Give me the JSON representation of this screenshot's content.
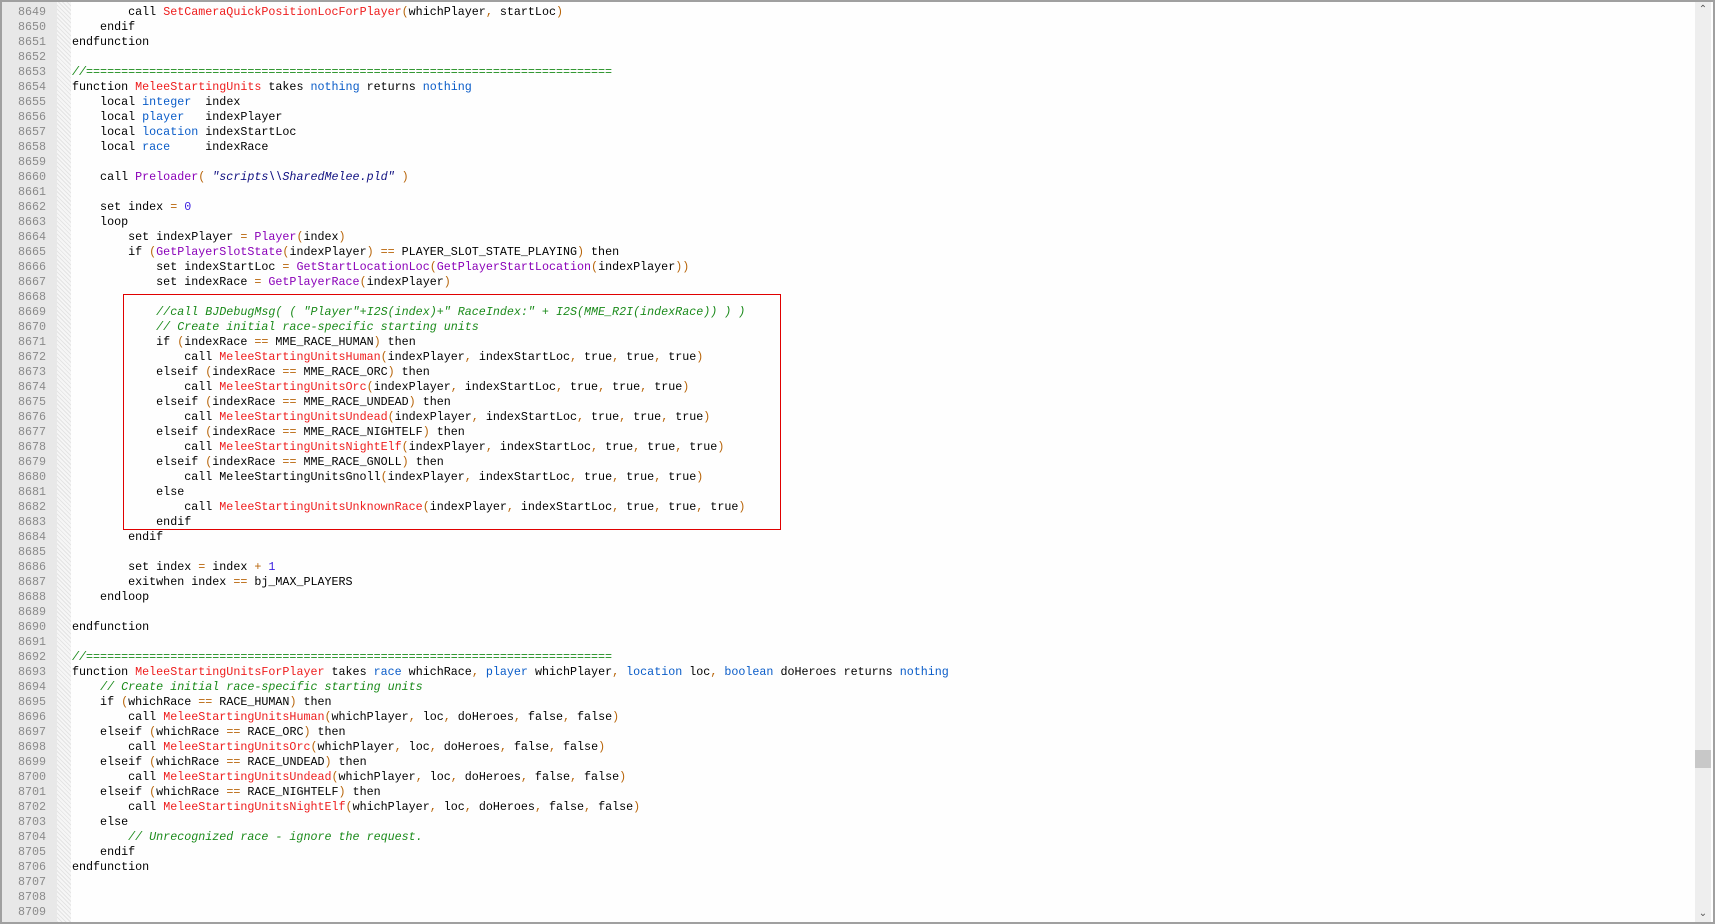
{
  "editor": {
    "first_line": 8649,
    "scroll_fraction": 0.82,
    "highlight_box_lines": [
      8669,
      8683
    ],
    "lines": [
      "        call SetCameraQuickPositionLocForPlayer(whichPlayer, startLoc)",
      "    endif",
      "endfunction",
      "",
      "//===========================================================================",
      "function MeleeStartingUnits takes nothing returns nothing",
      "    local integer  index",
      "    local player   indexPlayer",
      "    local location indexStartLoc",
      "    local race     indexRace",
      "",
      "    call Preloader( \"scripts\\\\SharedMelee.pld\" )",
      "",
      "    set index = 0",
      "    loop",
      "        set indexPlayer = Player(index)",
      "        if (GetPlayerSlotState(indexPlayer) == PLAYER_SLOT_STATE_PLAYING) then",
      "            set indexStartLoc = GetStartLocationLoc(GetPlayerStartLocation(indexPlayer))",
      "            set indexRace = GetPlayerRace(indexPlayer)",
      "",
      "            //call BJDebugMsg( ( \"Player\"+I2S(index)+\" RaceIndex:\" + I2S(MME_R2I(indexRace)) ) )",
      "            // Create initial race-specific starting units",
      "            if (indexRace == MME_RACE_HUMAN) then",
      "                call MeleeStartingUnitsHuman(indexPlayer, indexStartLoc, true, true, true)",
      "            elseif (indexRace == MME_RACE_ORC) then",
      "                call MeleeStartingUnitsOrc(indexPlayer, indexStartLoc, true, true, true)",
      "            elseif (indexRace == MME_RACE_UNDEAD) then",
      "                call MeleeStartingUnitsUndead(indexPlayer, indexStartLoc, true, true, true)",
      "            elseif (indexRace == MME_RACE_NIGHTELF) then",
      "                call MeleeStartingUnitsNightElf(indexPlayer, indexStartLoc, true, true, true)",
      "            elseif (indexRace == MME_RACE_GNOLL) then",
      "                call MeleeStartingUnitsGnoll(indexPlayer, indexStartLoc, true, true, true)",
      "            else",
      "                call MeleeStartingUnitsUnknownRace(indexPlayer, indexStartLoc, true, true, true)",
      "            endif",
      "        endif",
      "",
      "        set index = index + 1",
      "        exitwhen index == bj_MAX_PLAYERS",
      "    endloop",
      "",
      "endfunction",
      "",
      "//===========================================================================",
      "function MeleeStartingUnitsForPlayer takes race whichRace, player whichPlayer, location loc, boolean doHeroes returns nothing",
      "    // Create initial race-specific starting units",
      "    if (whichRace == RACE_HUMAN) then",
      "        call MeleeStartingUnitsHuman(whichPlayer, loc, doHeroes, false, false)",
      "    elseif (whichRace == RACE_ORC) then",
      "        call MeleeStartingUnitsOrc(whichPlayer, loc, doHeroes, false, false)",
      "    elseif (whichRace == RACE_UNDEAD) then",
      "        call MeleeStartingUnitsUndead(whichPlayer, loc, doHeroes, false, false)",
      "    elseif (whichRace == RACE_NIGHTELF) then",
      "        call MeleeStartingUnitsNightElf(whichPlayer, loc, doHeroes, false, false)",
      "    else",
      "        // Unrecognized race - ignore the request.",
      "    endif",
      "endfunction",
      "",
      "",
      ""
    ]
  },
  "syntax": {
    "types": [
      "nothing",
      "integer",
      "player",
      "location",
      "race",
      "boolean"
    ],
    "natives": [
      "Preloader",
      "Player",
      "GetPlayerSlotState",
      "GetStartLocationLoc",
      "GetPlayerStartLocation",
      "GetPlayerRace"
    ],
    "bj_functions": [
      "SetCameraQuickPositionLocForPlayer",
      "MeleeStartingUnits",
      "MeleeStartingUnitsHuman",
      "MeleeStartingUnitsOrc",
      "MeleeStartingUnitsUndead",
      "MeleeStartingUnitsNightElf",
      "MeleeStartingUnitsUnknownRace",
      "MeleeStartingUnitsForPlayer"
    ]
  },
  "scrollbar": {
    "up_icon": "chevron-up-icon",
    "down_icon": "chevron-down-icon"
  }
}
